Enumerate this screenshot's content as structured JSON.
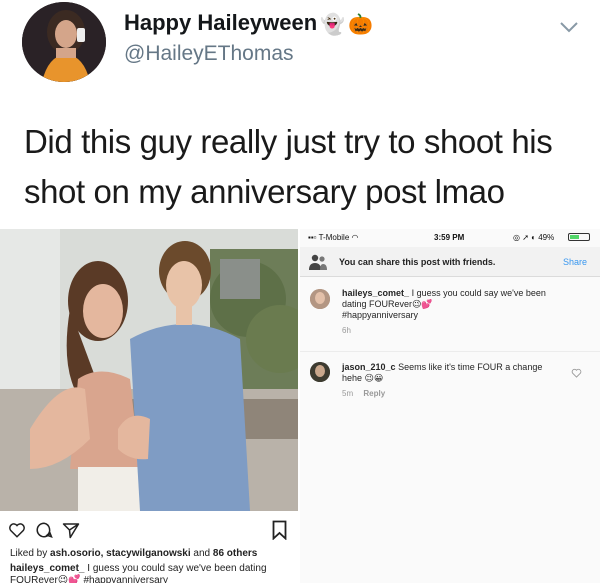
{
  "tweet": {
    "display_name": "Happy Haileyween",
    "name_emojis": [
      "👻",
      "🎃"
    ],
    "handle": "@HaileyEThomas",
    "text": "Did this guy really just try to shoot his shot on my anniversary post lmao"
  },
  "instagram_post": {
    "liked_prefix": "Liked by",
    "liked_users": "ash.osorio, stacywilganowski",
    "liked_middle": "and",
    "liked_count": "86 others",
    "caption_user": "haileys_comet_",
    "caption_text": "I guess you could say we've been dating FOURever",
    "caption_emojis": "😉💕",
    "caption_hashtag": "#happyanniversary"
  },
  "phone": {
    "carrier": "T-Mobile",
    "time": "3:59 PM",
    "battery": "49%",
    "share_message": "You can share this post with friends.",
    "share_label": "Share",
    "comments": [
      {
        "user": "haileys_comet_",
        "text": "I guess you could say we've been dating FOURever",
        "emojis": "😉💕",
        "hashtag": "#happyanniversary",
        "time": "6h"
      },
      {
        "user": "jason_210_c",
        "text": "Seems like it's time FOUR a change hehe",
        "emojis": "😉😀",
        "time": "5m",
        "reply_label": "Reply"
      }
    ]
  },
  "colors": {
    "twitter_gray": "#657786",
    "instagram_blue": "#3897f0",
    "text_dark": "#14171a"
  },
  "icons": [
    "chevron-down-icon",
    "heart-icon",
    "comment-icon",
    "send-icon",
    "bookmark-icon",
    "wifi-icon",
    "battery-icon",
    "share-people-icon"
  ]
}
